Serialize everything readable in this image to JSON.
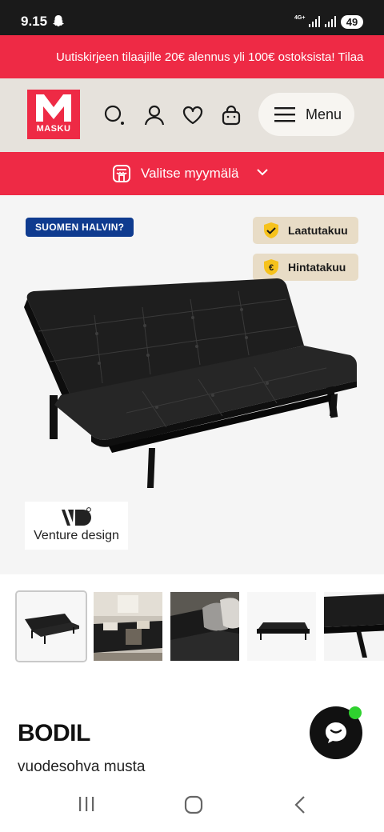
{
  "status_bar": {
    "time": "9.15",
    "network": "4G+",
    "battery": "49"
  },
  "promo": {
    "text": "Uutiskirjeen tilaajille 20€ alennus yli 100€ ostoksista! Tilaa"
  },
  "header": {
    "logo_text": "MASKU",
    "menu_label": "Menu"
  },
  "store": {
    "label": "Valitse myymälä"
  },
  "hero": {
    "badge": "SUOMEN HALVIN?",
    "pills": [
      {
        "label": "Laatutakuu",
        "icon": "shield-check-icon"
      },
      {
        "label": "Hintatakuu",
        "icon": "euro-shield-icon"
      }
    ],
    "brand": "Venture design"
  },
  "product": {
    "name": "BODIL",
    "description": "vuodesohva musta"
  },
  "colors": {
    "brand_red": "#ee2a45",
    "header_beige": "#e6e2dc",
    "badge_blue": "#0f3b8f",
    "pill_beige": "#e8dcc6",
    "online_green": "#2fd12f"
  }
}
